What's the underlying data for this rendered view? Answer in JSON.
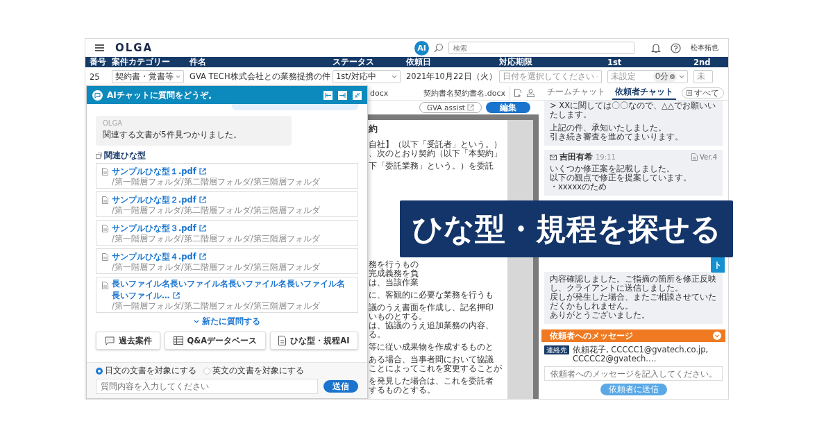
{
  "header": {
    "logo": "OLGA",
    "ai_badge": "AI",
    "search": {
      "placeholder": "検索"
    },
    "user": "松本拓也"
  },
  "case_table": {
    "columns": [
      "番号",
      "案件カテゴリー",
      "件名",
      "ステータス",
      "依頼日",
      "対応期限",
      "1st",
      "2nd"
    ],
    "row": [
      {
        "kind": "text",
        "value": "25"
      },
      {
        "kind": "select",
        "value": "契約書・覚書等"
      },
      {
        "kind": "text",
        "value": "GVA TECH株式会社との業務提携の件"
      },
      {
        "kind": "select",
        "value": "1st/対応中"
      },
      {
        "kind": "text",
        "value": "2021年10月22日（火）"
      },
      {
        "kind": "select",
        "placeholder": "日付を選択してください"
      },
      {
        "kind": "timer",
        "placeholder": "未設定",
        "badge": "0分"
      },
      {
        "kind": "cut",
        "placeholder": "未"
      }
    ]
  },
  "ai_chat": {
    "title": "AIチャットに質問をどうぞ。",
    "bot_message": {
      "sender": "OLGA",
      "text": "関連する文書が5件見つかりました。"
    },
    "section_label": "関連ひな型",
    "files": [
      {
        "name": "サンプルひな型１.pdf",
        "path": "/第一階層フォルダ/第二階層フォルダ/第三階層フォルダ"
      },
      {
        "name": "サンプルひな型２.pdf",
        "path": "/第一階層フォルダ/第二階層フォルダ/第三階層フォルダ"
      },
      {
        "name": "サンプルひな型３.pdf",
        "path": "/第一階層フォルダ/第二階層フォルダ/第三階層フォルダ"
      },
      {
        "name": "サンプルひな型４.pdf",
        "path": "/第一階層フォルダ/第二階層フォルダ/第三階層フォルダ"
      },
      {
        "name": "長いファイル名長いファイル名長いファイル名長いファイル名長いファイル…",
        "path": "/第一階層フォルダ/第二階層フォルダ/第三階層フォルダ"
      }
    ],
    "more": "新たに質問する",
    "tools": [
      {
        "kind": "chat",
        "label": "過去案件"
      },
      {
        "kind": "table",
        "label": "Q&Aデータベース"
      },
      {
        "kind": "document",
        "label": "ひな型・規程AI"
      }
    ],
    "language_options": [
      {
        "label": "日文の文書を対象にする",
        "selected": true
      },
      {
        "label": "英文の文書を対象にする",
        "selected": false
      }
    ],
    "input": {
      "placeholder": "質問内容を入力してください"
    },
    "send": "送信"
  },
  "document": {
    "tabs": [
      "docx",
      "契約書名契約書名.docx"
    ],
    "assist_button": "GVA assist",
    "edit_button": "編集",
    "title": "約",
    "paragraphs": [
      [
        "自社】（以下「受託者」という。）",
        "、次のとおり契約（以下「本契約」"
      ],
      [
        "下「委託業務」という。）を委託"
      ],
      [
        "務を行うもの",
        "完成義務を負",
        "は、当該作業"
      ],
      [
        "に、客観的に必要な業務を行うも"
      ],
      [
        "議のうえ書面を作成し、記名押印",
        "いものとする。",
        "は、協議のうえ追加業務の内容、",
        "る。"
      ],
      [
        "等に従い成果物を作成するものと"
      ],
      [
        "ある場合、当事者間において協議",
        "ことによってこれを変更することが"
      ],
      [
        "を発見した場合は、これを委託者",
        "するものとする。"
      ]
    ]
  },
  "chat": {
    "tabs": [
      {
        "label": "チームチャット",
        "selected": false
      },
      {
        "label": "依頼者チャット",
        "selected": true
      }
    ],
    "filter": "すべて",
    "messages": [
      {
        "kind": "plain",
        "paragraphs": [
          [
            "> XXに関しては〇〇なので、△△でお願いいたします。"
          ],
          [
            "上記の件、承知いたしました。",
            "引き続き審査を進めてまいります。"
          ]
        ]
      },
      {
        "kind": "mail",
        "sender": "吉田有希",
        "time": "19:11",
        "version": "Ver.4",
        "paragraphs": [
          [
            "いくつか修正案を記載しました。",
            "以下の観点で修正を提案しています。",
            "・xxxxxのため"
          ]
        ]
      },
      {
        "kind": "plain",
        "paragraphs": [
          [
            "内容確認しました。ご指摘の箇所を修正反映し、クライアントに送信しました。",
            "戻しが発生した場合、またご相談させていただくかもしれません。",
            "ありがとうございました。"
          ]
        ]
      }
    ],
    "composer": {
      "title": "依頼者へのメッセージ",
      "contact_tag": "連絡先",
      "recipients": "依頼花子, CCCCC1@gvatech.co.jp, CCCCC2@gvatech.…",
      "placeholder": "依頼者へのメッセージを記入してください。",
      "send": "依頼者に送信"
    },
    "side_tab": "ト"
  },
  "banner": "ひな型・規程を探せる"
}
